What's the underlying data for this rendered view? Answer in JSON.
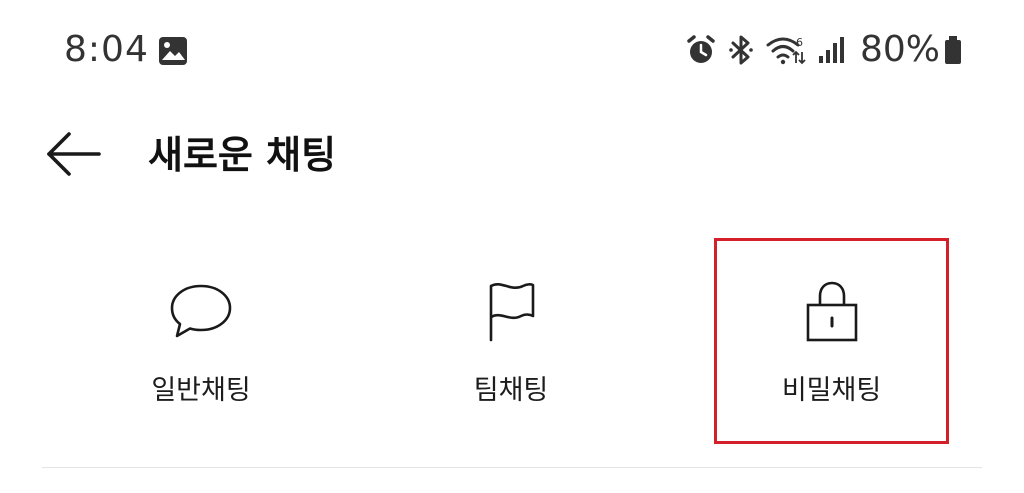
{
  "status_bar": {
    "time": "8:04",
    "battery_percent": "80%",
    "icons": [
      "gallery-icon",
      "alarm-icon",
      "bluetooth-icon",
      "wifi-icon",
      "signal-icon",
      "battery-icon"
    ]
  },
  "app_bar": {
    "back_icon": "arrow-left-icon",
    "title": "새로운 채팅"
  },
  "options": [
    {
      "label": "일반채팅",
      "icon": "speech-bubble-icon",
      "selected": false
    },
    {
      "label": "팀채팅",
      "icon": "flag-icon",
      "selected": false
    },
    {
      "label": "비밀채팅",
      "icon": "lock-icon",
      "selected": true
    }
  ],
  "colors": {
    "highlight_border": "#d4202a",
    "text": "#1c1c1c",
    "divider": "#e4e4e4"
  }
}
